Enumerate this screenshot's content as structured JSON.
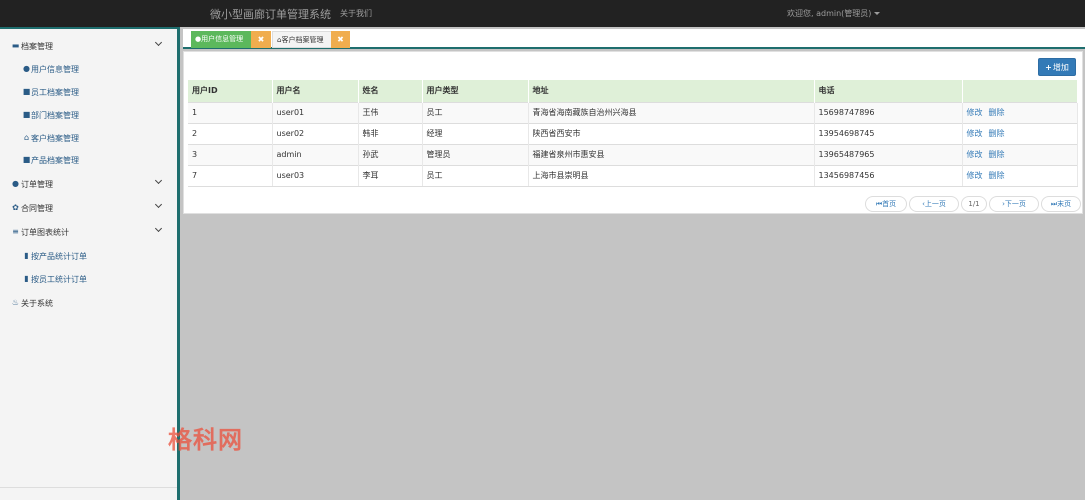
{
  "header": {
    "brand": "微小型画廊订单管理系统",
    "about": "关于我们",
    "user_menu": "欢迎您, admin(管理员)"
  },
  "sidebar": {
    "items": [
      {
        "label": "档案管理",
        "icon": "id-card-icon",
        "level": "top",
        "expandable": true
      },
      {
        "label": "用户信息管理",
        "icon": "user-icon",
        "level": "sub"
      },
      {
        "label": "员工档案管理",
        "icon": "print-icon",
        "level": "sub"
      },
      {
        "label": "部门档案管理",
        "icon": "print-icon",
        "level": "sub"
      },
      {
        "label": "客户档案管理",
        "icon": "home-icon",
        "level": "sub"
      },
      {
        "label": "产品档案管理",
        "icon": "print-icon",
        "level": "sub"
      },
      {
        "label": "订单管理",
        "icon": "user-icon",
        "level": "top",
        "expandable": true
      },
      {
        "label": "合同管理",
        "icon": "gear-icon",
        "level": "top",
        "expandable": true
      },
      {
        "label": "订单图表统计",
        "icon": "list-icon",
        "level": "top",
        "expandable": true
      },
      {
        "label": "按产品统计订单",
        "icon": "bar-chart-icon",
        "level": "sub"
      },
      {
        "label": "按员工统计订单",
        "icon": "bar-chart-icon",
        "level": "sub"
      },
      {
        "label": "关于系统",
        "icon": "fire-icon",
        "level": "top",
        "expandable": false
      }
    ]
  },
  "tabs": [
    {
      "label": "用户信息管理",
      "icon": "user-icon",
      "active": true
    },
    {
      "label": "客户档案管理",
      "icon": "home-icon",
      "active": false
    }
  ],
  "toolbar": {
    "add_label": "增加"
  },
  "table": {
    "columns": [
      "用户ID",
      "用户名",
      "姓名",
      "用户类型",
      "地址",
      "电话",
      ""
    ],
    "rows": [
      {
        "id": "1",
        "username": "user01",
        "name": "王伟",
        "type": "员工",
        "address": "青海省海南藏族自治州兴海县",
        "phone": "15698747896",
        "edit": "修改",
        "delete": "删除"
      },
      {
        "id": "2",
        "username": "user02",
        "name": "韩非",
        "type": "经理",
        "address": "陕西省西安市",
        "phone": "13954698745",
        "edit": "修改",
        "delete": "删除"
      },
      {
        "id": "3",
        "username": "admin",
        "name": "孙武",
        "type": "管理员",
        "address": "福建省泉州市惠安县",
        "phone": "13965487965",
        "edit": "修改",
        "delete": "删除"
      },
      {
        "id": "7",
        "username": "user03",
        "name": "李耳",
        "type": "员工",
        "address": "上海市县崇明县",
        "phone": "13456987456",
        "edit": "修改",
        "delete": "删除"
      }
    ]
  },
  "pagination": {
    "first": "首页",
    "prev": "上一页",
    "current": "1/1",
    "next": "下一页",
    "last": "末页"
  },
  "watermark": "格科网",
  "colors": {
    "primary": "#337ab7",
    "success": "#5cb85c",
    "warning": "#f0ad4e",
    "nav_bg": "#222222",
    "accent": "#1e6e6e"
  }
}
